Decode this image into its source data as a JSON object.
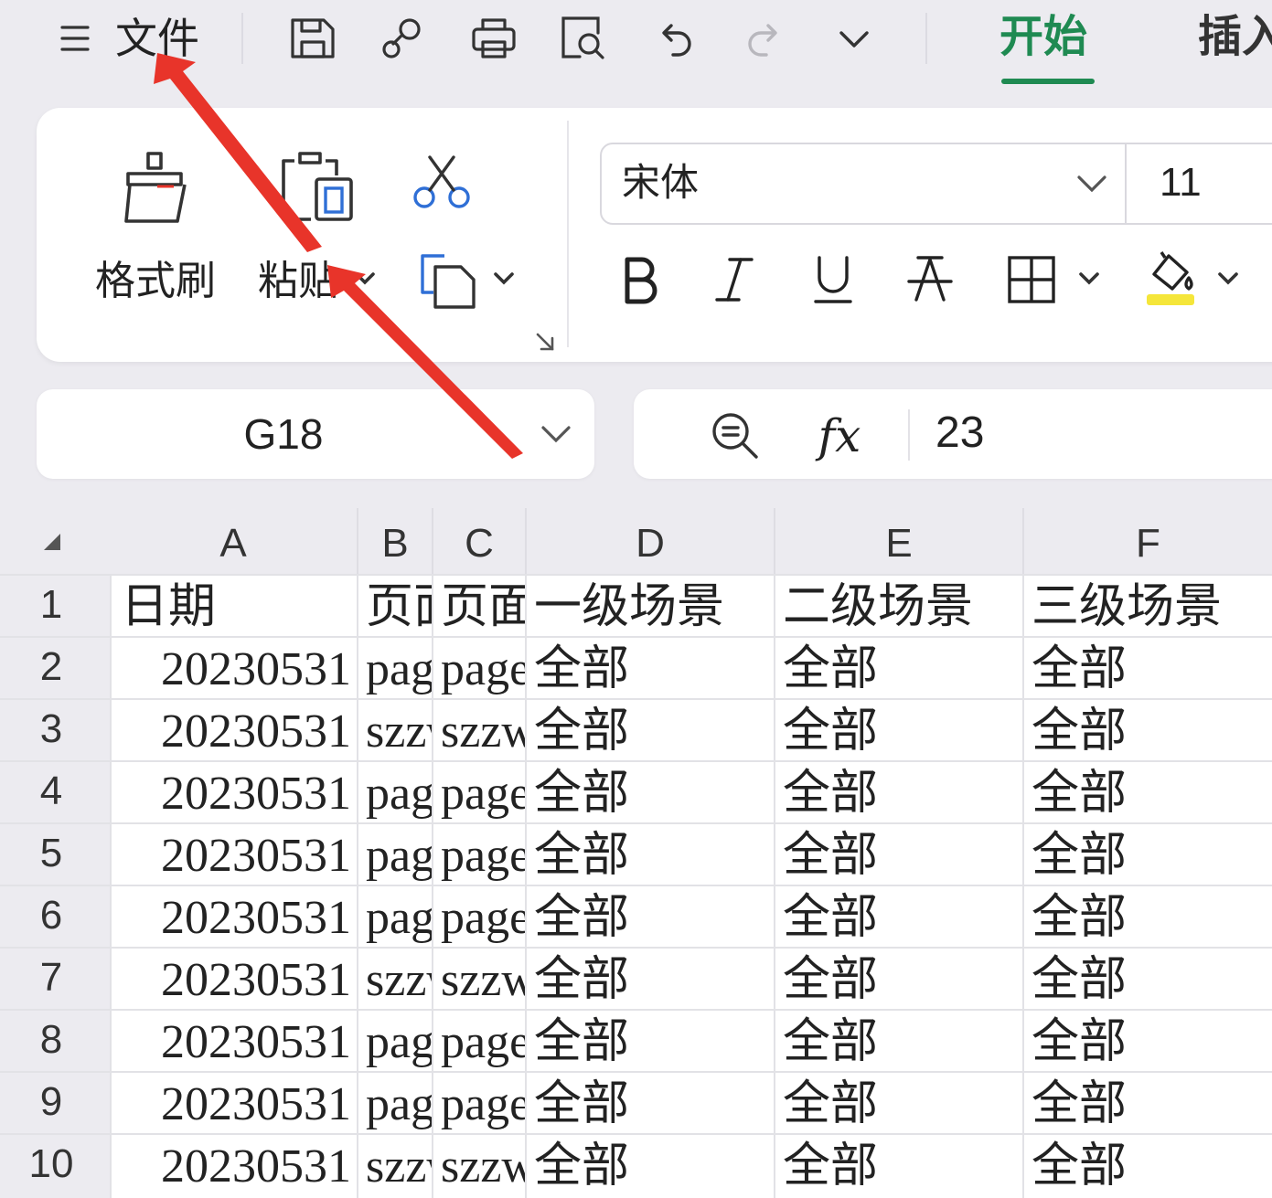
{
  "toolbar": {
    "menu_icon": "hamburger-icon",
    "file_label": "文件",
    "icons": [
      "save-icon",
      "format-painter-link-icon",
      "print-icon",
      "print-preview-icon",
      "undo-icon",
      "redo-icon",
      "more-chevron-icon"
    ],
    "tabs": [
      {
        "label": "开始",
        "active": true
      },
      {
        "label": "插入",
        "active": false
      }
    ],
    "active_color": "#1f8a52"
  },
  "ribbon": {
    "format_painter_label": "格式刷",
    "paste_label": "粘贴",
    "font_name": "宋体",
    "font_size": "11",
    "format_buttons": [
      "bold-icon",
      "italic-icon",
      "underline-icon",
      "strikethrough-icon",
      "borders-icon",
      "fill-color-icon"
    ],
    "fill_color": "#f5e63a"
  },
  "formula_bar": {
    "name_box": "G18",
    "fx_label": "fx",
    "value": "23"
  },
  "sheet": {
    "columns": [
      "A",
      "B",
      "C",
      "D",
      "E",
      "F"
    ],
    "rows": [
      {
        "n": "1",
        "A": "日期",
        "B": "页面",
        "C": "页面",
        "D": "一级场景",
        "E": "二级场景",
        "F": "三级场景"
      },
      {
        "n": "2",
        "A": "20230531",
        "B": "page",
        "C": "page",
        "D": "全部",
        "E": "全部",
        "F": "全部"
      },
      {
        "n": "3",
        "A": "20230531",
        "B": "szzw",
        "C": "szzw",
        "D": "全部",
        "E": "全部",
        "F": "全部"
      },
      {
        "n": "4",
        "A": "20230531",
        "B": "page",
        "C": "page",
        "D": "全部",
        "E": "全部",
        "F": "全部"
      },
      {
        "n": "5",
        "A": "20230531",
        "B": "page",
        "C": "page",
        "D": "全部",
        "E": "全部",
        "F": "全部"
      },
      {
        "n": "6",
        "A": "20230531",
        "B": "page",
        "C": "page",
        "D": "全部",
        "E": "全部",
        "F": "全部"
      },
      {
        "n": "7",
        "A": "20230531",
        "B": "szzw",
        "C": "szzw",
        "D": "全部",
        "E": "全部",
        "F": "全部"
      },
      {
        "n": "8",
        "A": "20230531",
        "B": "page",
        "C": "page",
        "D": "全部",
        "E": "全部",
        "F": "全部"
      },
      {
        "n": "9",
        "A": "20230531",
        "B": "page",
        "C": "page",
        "D": "全部",
        "E": "全部",
        "F": "全部"
      },
      {
        "n": "10",
        "A": "20230531",
        "B": "szzw",
        "C": "szzw",
        "D": "全部",
        "E": "全部",
        "F": "全部"
      }
    ]
  },
  "annotations": {
    "arrow_color": "#e8342a",
    "arrows": [
      "arrow-to-file-menu",
      "arrow-to-paste"
    ]
  }
}
